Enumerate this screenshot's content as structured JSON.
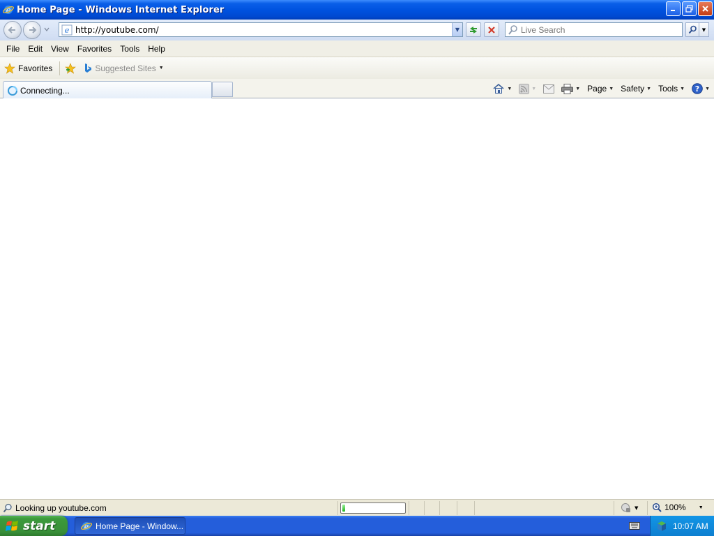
{
  "window": {
    "title": "Home Page - Windows Internet Explorer"
  },
  "address_bar": {
    "url": "http://youtube.com/"
  },
  "search": {
    "placeholder": "Live Search"
  },
  "menu": {
    "items": [
      "File",
      "Edit",
      "View",
      "Favorites",
      "Tools",
      "Help"
    ]
  },
  "favorites_bar": {
    "favorites_label": "Favorites",
    "suggested_label": "Suggested Sites"
  },
  "tab": {
    "label": "Connecting..."
  },
  "command_bar": {
    "page_label": "Page",
    "safety_label": "Safety",
    "tools_label": "Tools"
  },
  "status_bar": {
    "text": "Looking up youtube.com",
    "progress_fraction": 0.05,
    "zoom": "100%"
  },
  "taskbar": {
    "start_label": "start",
    "task_label": "Home Page - Window...",
    "clock": "10:07 AM"
  }
}
